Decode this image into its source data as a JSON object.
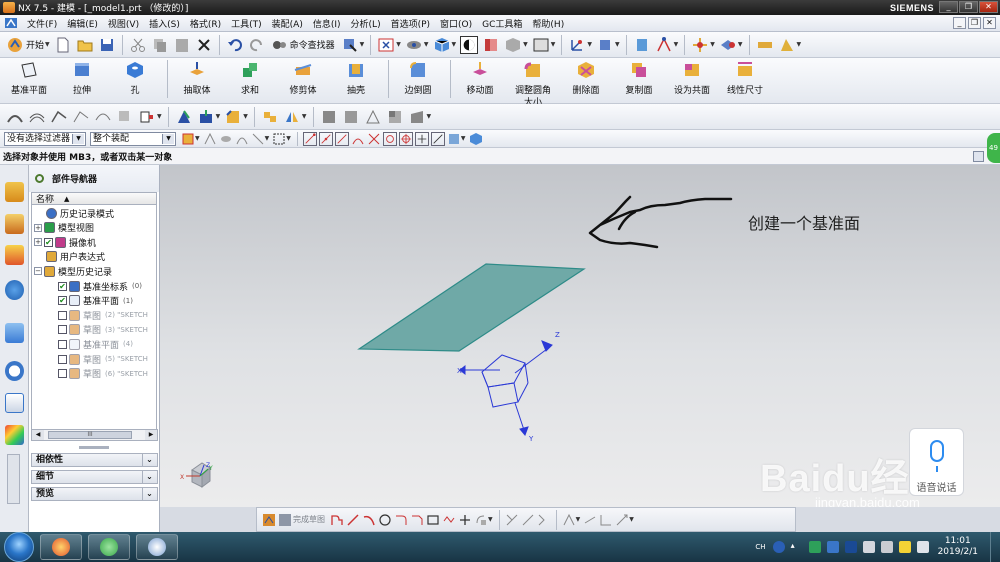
{
  "window": {
    "title": "NX 7.5 - 建模 - [_model1.prt （修改的）]",
    "brand": "SIEMENS",
    "controls": [
      "_",
      "❐",
      "✕"
    ]
  },
  "menubar": {
    "items": [
      "文件(F)",
      "编辑(E)",
      "视图(V)",
      "插入(S)",
      "格式(R)",
      "工具(T)",
      "装配(A)",
      "信息(I)",
      "分析(L)",
      "首选项(P)",
      "窗口(O)",
      "GC工具箱",
      "帮助(H)"
    ],
    "right_controls": [
      "_",
      "❐",
      "✕"
    ]
  },
  "toolbar_standard": {
    "start_label": "开始",
    "command_finder_label": "命令查找器"
  },
  "feature_toolbar": {
    "buttons": [
      {
        "label": "基准平面",
        "icon": "datum-plane-icon",
        "color": "#e8eef8"
      },
      {
        "label": "拉伸",
        "icon": "extrude-icon",
        "color": "#4a7fd0"
      },
      {
        "label": "孔",
        "icon": "hole-icon",
        "color": "#3a7bd5"
      },
      {
        "label": "抽取体",
        "icon": "extract-body-icon",
        "color": "#e9a23b"
      },
      {
        "label": "求和",
        "icon": "unite-icon",
        "color": "#2ea05a"
      },
      {
        "label": "修剪体",
        "icon": "trim-body-icon",
        "color": "#e9a23b"
      },
      {
        "label": "抽壳",
        "icon": "shell-icon",
        "color": "#5a8ed8"
      },
      {
        "label": "边倒圆",
        "icon": "edge-blend-icon",
        "color": "#e9b03b"
      }
    ],
    "sync_buttons": [
      {
        "label": "移动面",
        "icon": "move-face-icon",
        "color": "#c94f9a"
      },
      {
        "label": "调整圆角大小",
        "label_line1": "调整圆角",
        "label_line2": "大小",
        "icon": "resize-blend-icon",
        "color": "#c94f9a"
      },
      {
        "label": "删除面",
        "icon": "delete-face-icon",
        "color": "#c94f9a"
      },
      {
        "label": "复制面",
        "icon": "copy-face-icon",
        "color": "#c94f9a"
      },
      {
        "label": "设为共面",
        "icon": "make-coplanar-icon",
        "color": "#c94f9a"
      },
      {
        "label": "线性尺寸",
        "icon": "linear-dimension-icon",
        "color": "#c94f9a"
      }
    ]
  },
  "selection_bar": {
    "filter_value": "没有选择过滤器",
    "scope_value": "整个装配"
  },
  "status": {
    "prompt": "选择对象并使用 MB3，或者双击某一对象"
  },
  "navigator": {
    "title": "部件导航器",
    "column_name": "名称",
    "sort_indicator": "▲",
    "tree": [
      {
        "label": "历史记录模式",
        "indent": 1,
        "expander": "",
        "checkbox": "",
        "icon": "history-mode-icon",
        "icon_color": "#3a6fc5",
        "dim": false,
        "extra": ""
      },
      {
        "label": "模型视图",
        "indent": 0,
        "expander": "+",
        "checkbox": "",
        "icon": "model-views-icon",
        "icon_color": "#2a9d4a",
        "dim": false,
        "extra": ""
      },
      {
        "label": "摄像机",
        "indent": 0,
        "expander": "+",
        "checkbox": "✔",
        "icon": "camera-icon",
        "icon_color": "#c03b8a",
        "dim": false,
        "extra": ""
      },
      {
        "label": "用户表达式",
        "indent": 1,
        "expander": "",
        "checkbox": "",
        "icon": "user-expressions-icon",
        "icon_color": "#e0a93a",
        "dim": false,
        "extra": ""
      },
      {
        "label": "模型历史记录",
        "indent": 0,
        "expander": "−",
        "checkbox": "",
        "icon": "model-history-folder-icon",
        "icon_color": "#e0a93a",
        "dim": false,
        "extra": ""
      },
      {
        "label": "基准坐标系",
        "indent": 2,
        "expander": "",
        "checkbox": "✔",
        "icon": "datum-csys-icon",
        "icon_color": "#3a6fc5",
        "dim": false,
        "extra": "(0)"
      },
      {
        "label": "基准平面",
        "indent": 2,
        "expander": "",
        "checkbox": "✔",
        "icon": "datum-plane-icon",
        "icon_color": "#e8eef8",
        "dim": false,
        "extra": "(1)"
      },
      {
        "label": "草图",
        "indent": 2,
        "expander": "",
        "checkbox": " ",
        "icon": "sketch-icon",
        "icon_color": "#d88a2e",
        "dim": true,
        "extra": "(2) \"SKETCH"
      },
      {
        "label": "草图",
        "indent": 2,
        "expander": "",
        "checkbox": " ",
        "icon": "sketch-icon",
        "icon_color": "#d88a2e",
        "dim": true,
        "extra": "(3) \"SKETCH"
      },
      {
        "label": "基准平面",
        "indent": 2,
        "expander": "",
        "checkbox": " ",
        "icon": "datum-plane-icon",
        "icon_color": "#e8eef8",
        "dim": true,
        "extra": "(4)"
      },
      {
        "label": "草图",
        "indent": 2,
        "expander": "",
        "checkbox": " ",
        "icon": "sketch-icon",
        "icon_color": "#d88a2e",
        "dim": true,
        "extra": "(5) \"SKETCH"
      },
      {
        "label": "草图",
        "indent": 2,
        "expander": "",
        "checkbox": " ",
        "icon": "sketch-icon",
        "icon_color": "#d88a2e",
        "dim": true,
        "extra": "(6) \"SKETCH"
      }
    ],
    "scroll_thumb": "III",
    "sections": [
      {
        "label": "相依性",
        "icon": "chevron-down-icon"
      },
      {
        "label": "细节",
        "icon": "chevron-down-icon"
      },
      {
        "label": "预览",
        "icon": "chevron-down-icon"
      }
    ]
  },
  "graphics": {
    "annotation_text": "创建一个基准面",
    "plane_fill": "#6fa9a7",
    "plane_stroke": "#2e8b88",
    "csys_color": "#2b39d6",
    "axis_labels": {
      "x": "X",
      "y": "Y",
      "z": "Z"
    },
    "mini_triad_labels": {
      "x": "X",
      "y": "Y",
      "z": "Z"
    }
  },
  "overlay": {
    "voice_label": "语音说话",
    "watermark": "Baidu经验",
    "watermark_url": "jingyan.baidu.com"
  },
  "sketch_toolbar": {
    "finish_sketch_label": "完成草图"
  },
  "taskbar": {
    "apps": [
      {
        "name": "browser-icon",
        "color": "#e2552f"
      },
      {
        "name": "nx-icon",
        "color": "#39a64a"
      },
      {
        "name": "paint-icon",
        "color": "#7a9fd1"
      }
    ],
    "tray_lang": "CH",
    "time": "11:01",
    "date": "2019/2/1"
  },
  "side_badge": "49"
}
